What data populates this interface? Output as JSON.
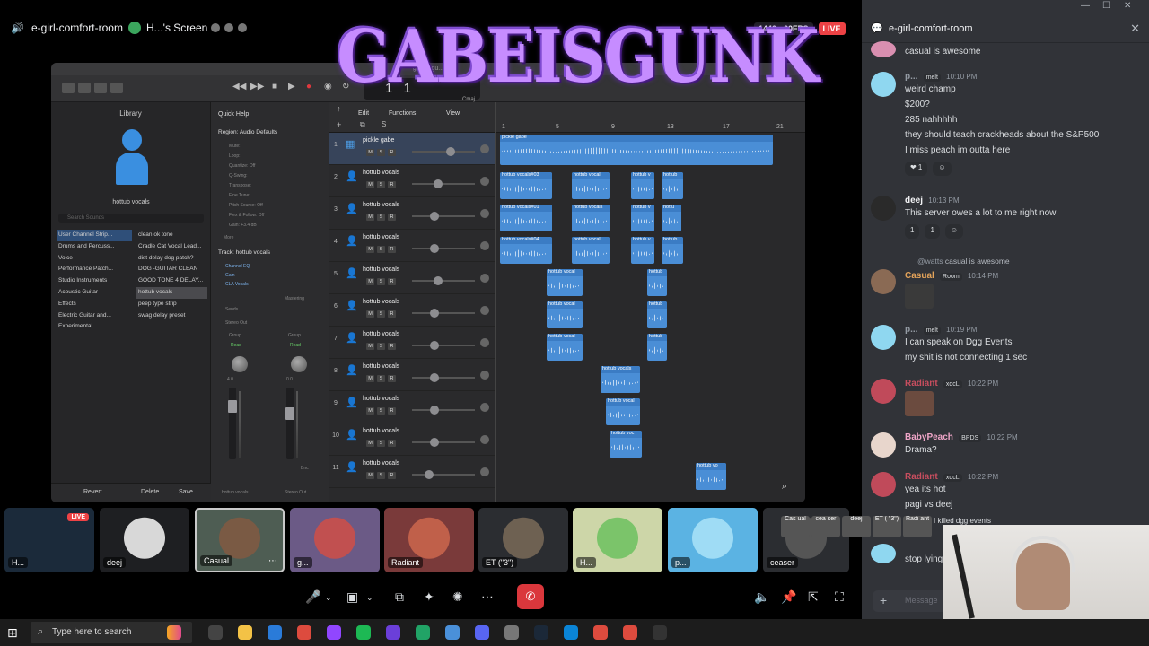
{
  "window": {
    "controls": [
      "—",
      "☐",
      "✕"
    ]
  },
  "voice": {
    "channel_name": "e-girl-comfort-room",
    "stream_title": "H...'s Screen"
  },
  "stream": {
    "quality": "1440p 60FPS",
    "live": "LIVE"
  },
  "logo_text": "GABEISGUNK",
  "logic": {
    "window_title": "gabeisgu...",
    "lcd": {
      "bar": "1",
      "beat": "1",
      "key": "Cmaj"
    },
    "library_title": "Library",
    "library_patch": "hottub vocals",
    "search_placeholder": "Search Sounds",
    "categories": [
      "User Channel Strip...",
      "Drums and Percuss...",
      "Voice",
      "Performance Patch...",
      "Studio Instruments",
      "Acoustic Guitar",
      "Effects",
      "Electric Guitar and...",
      "Experimental"
    ],
    "items": [
      "clean ok tone",
      "Cradle Cat Vocal Lead...",
      "dist delay dog patch?",
      "DOG -GUITAR CLEAN",
      "GOOD TONE 4 DELAY...",
      "hottub vocals",
      "peep type strip",
      "swag delay preset"
    ],
    "revert_label": "Revert",
    "delete_label": "Delete",
    "save_label": "Save...",
    "quick_help": "Quick Help",
    "region_label": "Region: Audio Defaults",
    "region_params": [
      "Mute:",
      "Loop:",
      "Quantize: Off",
      "Q-Swing:",
      "Transpose:",
      "Fine Tune:",
      "Pitch Source: Off",
      "Flex & Follow: Off",
      "Gain: +3.4 dB"
    ],
    "more_label": "More",
    "track_label": "Track:",
    "track_name": "hottub vocals",
    "strip": {
      "eq": "Channel EQ",
      "gain": "Gain",
      "cla": "CLA Vocals",
      "sends": "Sends",
      "stereo_out": "Stereo Out",
      "group": "Group",
      "read": "Read",
      "mastering": "Mastering",
      "vol_left": "4.0",
      "vol_right": "0.0",
      "bnc": "Bnc",
      "name_left": "hottub vocals",
      "name_right": "Stereo Out"
    },
    "menu": {
      "edit": "Edit",
      "functions": "Functions",
      "view": "View"
    },
    "msr": [
      "M",
      "S",
      "R"
    ],
    "ruler": [
      "1",
      "5",
      "9",
      "13",
      "17",
      "21"
    ],
    "tracks": [
      {
        "num": "1",
        "name": "pickle gabe"
      },
      {
        "num": "2",
        "name": "hottub vocals"
      },
      {
        "num": "3",
        "name": "hottub vocals"
      },
      {
        "num": "4",
        "name": "hottub vocals"
      },
      {
        "num": "5",
        "name": "hottub vocals"
      },
      {
        "num": "6",
        "name": "hottub vocals"
      },
      {
        "num": "7",
        "name": "hottub vocals"
      },
      {
        "num": "8",
        "name": "hottub vocals"
      },
      {
        "num": "9",
        "name": "hottub vocals"
      },
      {
        "num": "10",
        "name": "hottub vocals"
      },
      {
        "num": "11",
        "name": "hottub vocals"
      }
    ],
    "regions": [
      "pickle gabe",
      "hottub vocals#03",
      "hottub vocal",
      "hottub v",
      "hottub",
      "hottub vocals#01",
      "hottub vocals",
      "hottub v",
      "hottu",
      "hottub vocals#04",
      "hottub vocal",
      "hottub v",
      "hottub",
      "hottub vocal",
      "hottub",
      "hottub vocal",
      "hottub",
      "hottub vocal",
      "hottub",
      "hottub vocals",
      "hottub vocal",
      "hottub voc",
      "hottub vo"
    ]
  },
  "participants": [
    {
      "name": "H...",
      "live": "LIVE"
    },
    {
      "name": "deej"
    },
    {
      "name": "Casual"
    },
    {
      "name": "g..."
    },
    {
      "name": "Radiant"
    },
    {
      "name": "ET (\"3\")"
    },
    {
      "name": "H..."
    },
    {
      "name": "p..."
    },
    {
      "name": "ceaser"
    }
  ],
  "chat": {
    "title": "e-girl-comfort-room",
    "messages": [
      {
        "author": "",
        "lines": [
          "casual is awesome"
        ]
      },
      {
        "author": "p...",
        "tag": "melt",
        "time": "10:10 PM",
        "lines": [
          "weird champ",
          "$200?",
          "285 nahhhhh",
          "they should teach crackheads about the S&P500",
          "I miss peach im outta here"
        ],
        "reactions": [
          "❤ 1"
        ]
      },
      {
        "author": "deej",
        "time": "10:13 PM",
        "lines": [
          "This server owes a lot to me right now"
        ],
        "reactions": [
          "1",
          "1"
        ]
      },
      {
        "author": "Casual",
        "tag": "Room",
        "time": "10:14 PM",
        "reply_author": "@watts",
        "reply_text": "casual is awesome"
      },
      {
        "author": "p...",
        "tag": "melt",
        "time": "10:19 PM",
        "lines": [
          "I can speak on Dgg Events",
          "my shit is  not connecting 1 sec"
        ]
      },
      {
        "author": "Radiant",
        "tag": "xqcL",
        "time": "10:22 PM"
      },
      {
        "author": "BabyPeach",
        "tag": "BPDS",
        "time": "10:22 PM",
        "lines": [
          "Drama?"
        ]
      },
      {
        "author": "Radiant",
        "tag": "xqcL",
        "time": "10:22 PM",
        "lines": [
          "yea its hot",
          "pagi vs deej"
        ]
      },
      {
        "author": "",
        "lines": [
          "stop lying"
        ]
      }
    ],
    "input_placeholder": "Message",
    "overlay_names": [
      "Cas ual",
      "cea ser",
      "deej",
      "ET ( \"3\")",
      "Radi ant"
    ],
    "overlay_text": "I killed dgg events"
  },
  "taskbar": {
    "search_placeholder": "Type here to search"
  },
  "colors": {
    "discord_bg": "#313338",
    "accent_red": "#ed4245",
    "region_blue": "#4a8ed6",
    "online_green": "#3ba55d"
  }
}
